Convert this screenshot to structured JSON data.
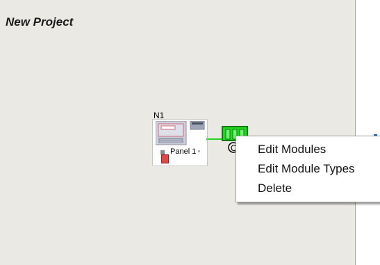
{
  "canvas": {
    "project_title": "New Project",
    "background": "#ebe9e3"
  },
  "node": {
    "label": "N1",
    "panel_name": "Panel 1"
  },
  "link_color": "#22d622",
  "module": {
    "label": "O",
    "color": "#22d622"
  },
  "context_menu": {
    "items": [
      {
        "label": "Edit Modules"
      },
      {
        "label": "Edit Module Types"
      },
      {
        "label": "Delete"
      }
    ]
  }
}
